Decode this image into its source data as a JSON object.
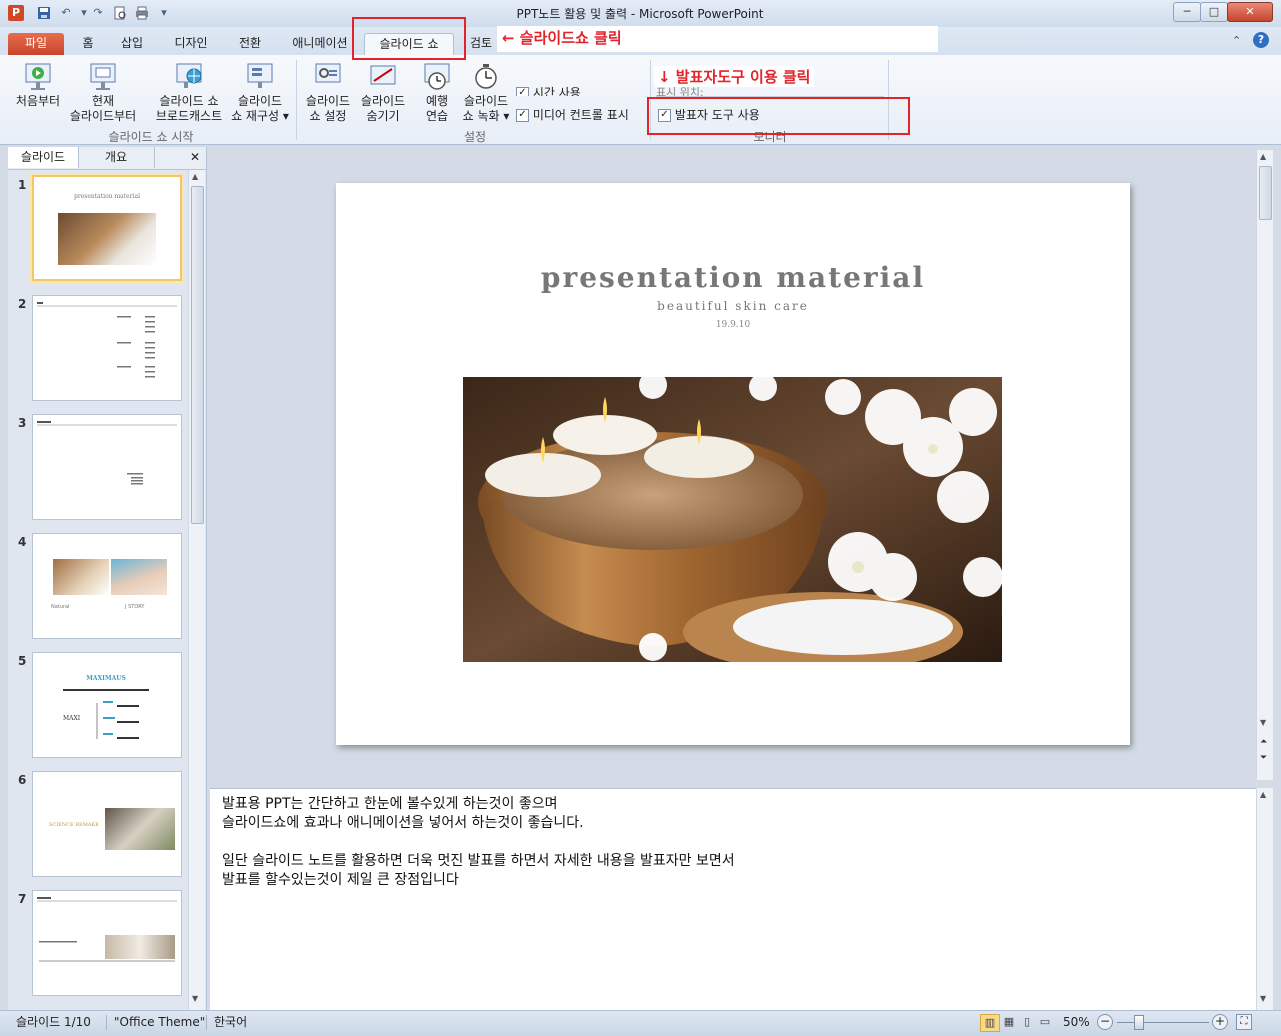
{
  "window": {
    "title": "PPT노트 활용 및 출력 - Microsoft PowerPoint",
    "app_icon": "P",
    "buttons": {
      "minimize": "─",
      "maximize": "□",
      "close": "✕"
    }
  },
  "quick_access": [
    "save-icon",
    "undo-icon",
    "redo-icon",
    "preview-icon",
    "print-icon",
    "customize-icon"
  ],
  "tabs": [
    {
      "label": "파일"
    },
    {
      "label": "홈"
    },
    {
      "label": "삽입"
    },
    {
      "label": "디자인"
    },
    {
      "label": "전환"
    },
    {
      "label": "애니메이션"
    },
    {
      "label": "슬라이드 쇼"
    },
    {
      "label": "검토"
    }
  ],
  "active_tab": "슬라이드 쇼",
  "annotations": {
    "slideshow_click": "← 슬라이드쇼 클릭",
    "presenter_click": "↓ 발표자도구 이용 클릭"
  },
  "ribbon": {
    "group_start": {
      "label": "슬라이드 쇼 시작",
      "buttons": [
        {
          "line1": "처음부터",
          "line2": ""
        },
        {
          "line1": "현재",
          "line2": "슬라이드부터"
        },
        {
          "line1": "슬라이드 쇼",
          "line2": "브로드캐스트"
        },
        {
          "line1": "슬라이드",
          "line2": "쇼 재구성 ▾"
        }
      ]
    },
    "group_setup": {
      "label": "설정",
      "buttons": [
        {
          "line1": "슬라이드",
          "line2": "쇼 설정"
        },
        {
          "line1": "슬라이드",
          "line2": "숨기기"
        },
        {
          "line1": "예행",
          "line2": "연습"
        },
        {
          "line1": "슬라이드",
          "line2": "쇼 녹화 ▾"
        }
      ],
      "checks": [
        {
          "label": "시간 사용",
          "checked": true
        },
        {
          "label": "미디어 컨트롤 표시",
          "checked": true
        }
      ]
    },
    "group_monitor": {
      "label": "모니터",
      "show_on": "표시 위치:",
      "checks": [
        {
          "label": "발표자 도구 사용",
          "checked": true
        }
      ]
    }
  },
  "panel": {
    "tabs": [
      "슬라이드",
      "개요"
    ],
    "close": "✕",
    "thumbs": [
      {
        "num": "1",
        "selected": true
      },
      {
        "num": "2"
      },
      {
        "num": "3"
      },
      {
        "num": "4"
      },
      {
        "num": "5"
      },
      {
        "num": "6"
      },
      {
        "num": "7"
      }
    ],
    "thumb_texts": {
      "t1_title": "presentation material",
      "t5_title": "MAXIMAUS",
      "t5_left": "MAXI",
      "t6_title": "SCIENCE REMAKE",
      "t4_caption": "Natural",
      "t4_caption2": "J STORY"
    }
  },
  "slide": {
    "title": "presentation   material",
    "subtitle": "beautiful skin care",
    "date": "19.9.10"
  },
  "notes": {
    "line1": "발표용 PPT는 간단하고 한눈에 볼수있게 하는것이 좋으며",
    "line2": "슬라이드쇼에 효과나 애니메이션을 넣어서 하는것이 좋습니다.",
    "line3": "",
    "line4": "일단 슬라이드 노트를 활용하면 더욱 멋진 발표를 하면서 자세한 내용을 발표자만 보면서",
    "line5": "발표를 할수있는것이 제일 큰 장점입니다"
  },
  "status": {
    "slide_info": "슬라이드 1/10",
    "theme": "\"Office Theme\"",
    "language": "한국어",
    "zoom": "50%",
    "zoom_level": 0.5
  },
  "colors": {
    "accent_red": "#e2232a",
    "file_tab": "#c6442c",
    "selected_thumb": "#f2c76a"
  }
}
